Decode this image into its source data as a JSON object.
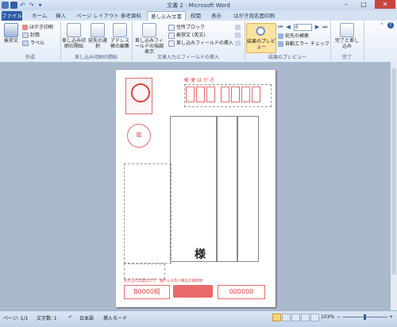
{
  "window": {
    "title": "文書 2 - Microsoft Word",
    "minimize": "–",
    "maximize": "□",
    "close": "✕"
  },
  "tabs": [
    {
      "label": "ファイル"
    },
    {
      "label": "ホーム"
    },
    {
      "label": "挿入"
    },
    {
      "label": "ページ レイアウト"
    },
    {
      "label": "参考資料"
    },
    {
      "label": "差し込み文書"
    },
    {
      "label": "校閲"
    },
    {
      "label": "表示"
    },
    {
      "label": "はがき宛名面印刷"
    }
  ],
  "ribbon": {
    "create": {
      "label": "作成",
      "greeting": "挨拶文",
      "postcard_print": "はがき印刷",
      "envelope": "封筒",
      "labels": "ラベル"
    },
    "start_merge": {
      "label": "差し込み印刷の開始",
      "start": "差し込み印刷の開始",
      "select_recipients": "宛先の選択",
      "edit_list": "アドレス帳の編集"
    },
    "write_insert": {
      "label": "文章入力とフィールドの挿入",
      "highlight": "差し込みフィールドの強調表示",
      "address_block": "住所ブロック",
      "greeting_line": "挨拶文 (英文)",
      "insert_field": "差し込みフィールドの挿入"
    },
    "preview": {
      "label": "結果のプレビュー",
      "preview_results": "結果のプレビュー",
      "record_number": "0",
      "find_recipient": "宛先の検索",
      "auto_check": "自動エラー チェック"
    },
    "finish": {
      "label": "完了",
      "finish_merge": "完了と差し込み"
    }
  },
  "postcard": {
    "stamp_label": "郵便はがき",
    "year_char": "年",
    "recipient_suffix": "様",
    "bottom_left_code": "B0000組",
    "bottom_right_code": "000000",
    "notice_text": "お年玉付年賀はがき　抽せん日及び賞品交換期間"
  },
  "status": {
    "page": "ページ: 1/1",
    "words": "文字数: 1",
    "language": "日本語",
    "mode": "挿入モード",
    "zoom": "103%"
  }
}
